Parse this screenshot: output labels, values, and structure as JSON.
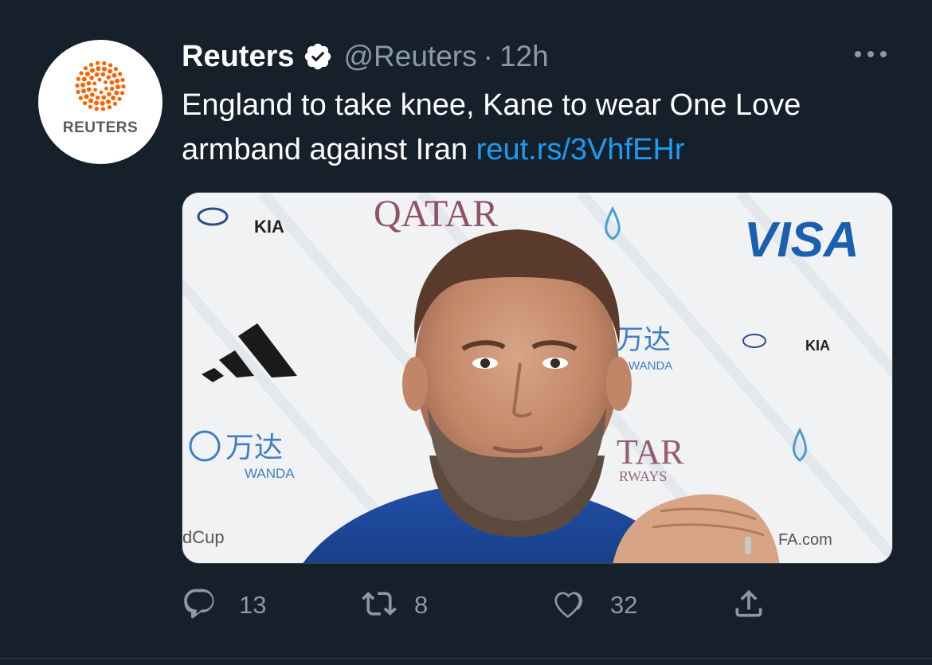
{
  "tweet": {
    "author": {
      "name": "Reuters",
      "handle": "@Reuters",
      "verified": true,
      "avatar_text": "REUTERS"
    },
    "separator": "·",
    "timestamp": "12h",
    "text": "England to take knee, Kane to wear One Love armband against Iran",
    "link": "reut.rs/3VhfEHr",
    "media": {
      "sponsor_texts": [
        "KIA",
        "QATAR",
        "VISA",
        "万达",
        "WANDA",
        "TAR",
        "RWAYS",
        "FA.com",
        "dCup"
      ]
    },
    "actions": {
      "replies": "13",
      "retweets": "8",
      "likes": "32"
    }
  },
  "colors": {
    "background": "#15202b",
    "text": "#ffffff",
    "secondary": "#8b98a5",
    "link": "#1d9bf0",
    "reuters_orange": "#fa6400"
  },
  "icons": [
    "verified-icon",
    "more-icon",
    "reply-icon",
    "retweet-icon",
    "like-icon",
    "share-icon"
  ]
}
